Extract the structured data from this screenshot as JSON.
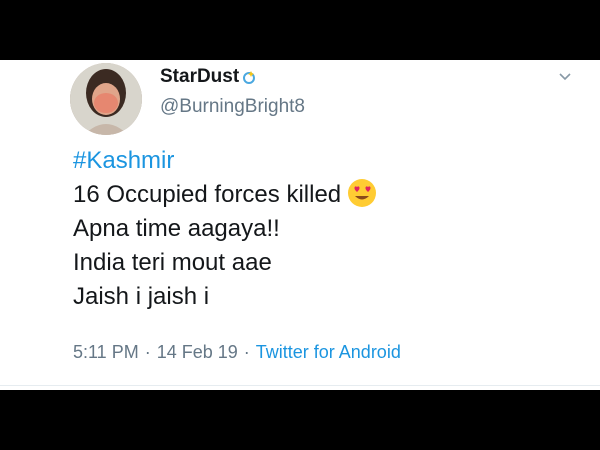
{
  "tweet": {
    "display_name": "StarDust",
    "handle": "@BurningBright8",
    "hashtag": "#Kashmir",
    "lines": [
      "16 Occupied forces killed",
      "Apna time aagaya!!",
      "India teri mout aae",
      "Jaish i jaish i"
    ],
    "emoji": "heart-eyes-face",
    "time": "5:11 PM",
    "date": "14 Feb 19",
    "source": "Twitter for Android",
    "separator": "·"
  },
  "colors": {
    "link": "#1b95e0",
    "secondary_text": "#657786",
    "primary_text": "#14171a",
    "frame": "#000000",
    "card": "#ffffff"
  }
}
